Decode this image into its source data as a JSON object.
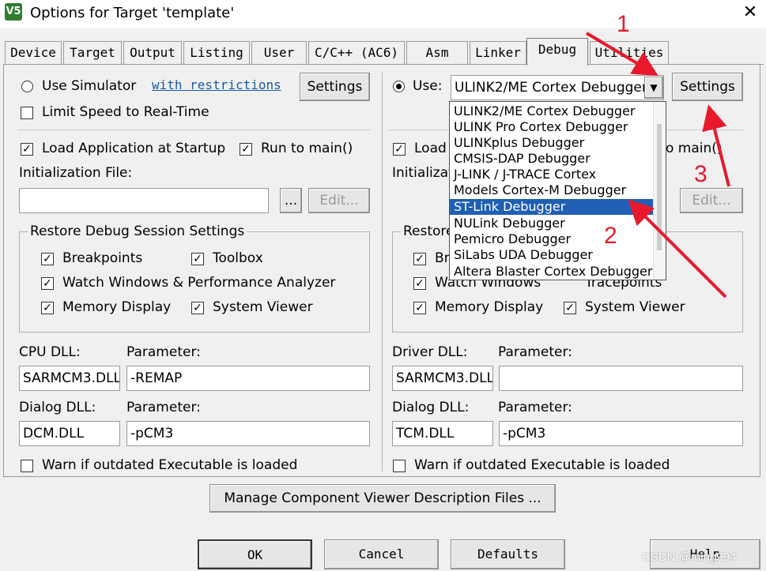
{
  "window": {
    "title": "Options for Target 'template'",
    "icon": "keil-app-icon",
    "close_glyph": "✕"
  },
  "tabs": [
    {
      "label": "Device"
    },
    {
      "label": "Target"
    },
    {
      "label": "Output"
    },
    {
      "label": "Listing"
    },
    {
      "label": "User"
    },
    {
      "label": "C/C++ (AC6)"
    },
    {
      "label": "Asm"
    },
    {
      "label": "Linker"
    },
    {
      "label": "Debug",
      "active": true
    },
    {
      "label": "Utilities"
    }
  ],
  "left": {
    "use_simulator": "Use Simulator",
    "restrictions_link": "with restrictions",
    "settings": "Settings",
    "limit_speed": "Limit Speed to Real-Time",
    "load_app": "Load Application at Startup",
    "run_to_main": "Run to main()",
    "init_file_label": "Initialization File:",
    "init_file_value": "",
    "browse": "...",
    "edit": "Edit...",
    "restore_title": "Restore Debug Session Settings",
    "breakpoints": "Breakpoints",
    "toolbox": "Toolbox",
    "watch": "Watch Windows & Performance Analyzer",
    "memory": "Memory Display",
    "system_viewer": "System Viewer",
    "cpu_dll_label": "CPU DLL:",
    "cpu_dll_value": "SARMCM3.DLL",
    "param_label": "Parameter:",
    "cpu_param_value": "-REMAP",
    "dialog_dll_label": "Dialog DLL:",
    "dialog_dll_value": "DCM.DLL",
    "dialog_param_value": "-pCM3",
    "warn": "Warn if outdated Executable is loaded"
  },
  "right": {
    "use": "Use:",
    "debugger_selected": "ULINK2/ME Cortex Debugger",
    "settings": "Settings",
    "load_app": "Load A",
    "run_to_main_partial": "o main()",
    "init_file_label": "Initializatio",
    "edit": "Edit...",
    "restore_partial": "Restore",
    "breakpoints_partial": "Bre",
    "watch_partial": "Watch Windows",
    "tracepoints_partial": "Tracepoints",
    "memory": "Memory Display",
    "system_viewer": "System Viewer",
    "driver_dll_label": "Driver DLL:",
    "driver_dll_value": "SARMCM3.DLL",
    "param_label": "Parameter:",
    "driver_param_value": "",
    "dialog_dll_label": "Dialog DLL:",
    "dialog_dll_value": "TCM.DLL",
    "dialog_param_value": "-pCM3",
    "warn": "Warn if outdated Executable is loaded"
  },
  "dropdown_items": [
    "ULINK2/ME Cortex Debugger",
    "ULINK Pro Cortex Debugger",
    "ULINKplus Debugger",
    "CMSIS-DAP Debugger",
    "J-LINK / J-TRACE Cortex",
    "Models Cortex-M Debugger",
    "ST-Link Debugger",
    "NULink Debugger",
    "Pemicro Debugger",
    "SiLabs UDA Debugger",
    "Altera Blaster Cortex Debugger"
  ],
  "dropdown_selected_index": 6,
  "manage_button": "Manage Component Viewer Description Files ...",
  "bottom": {
    "ok": "OK",
    "cancel": "Cancel",
    "defaults": "Defaults",
    "help": "Help"
  },
  "annotations": {
    "n1": "1",
    "n2": "2",
    "n3": "3"
  },
  "watermark": "CSDN @ming994",
  "colors": {
    "annotation": "#e8192c",
    "selection": "#1f5fb4",
    "link": "#1a5aa8"
  }
}
